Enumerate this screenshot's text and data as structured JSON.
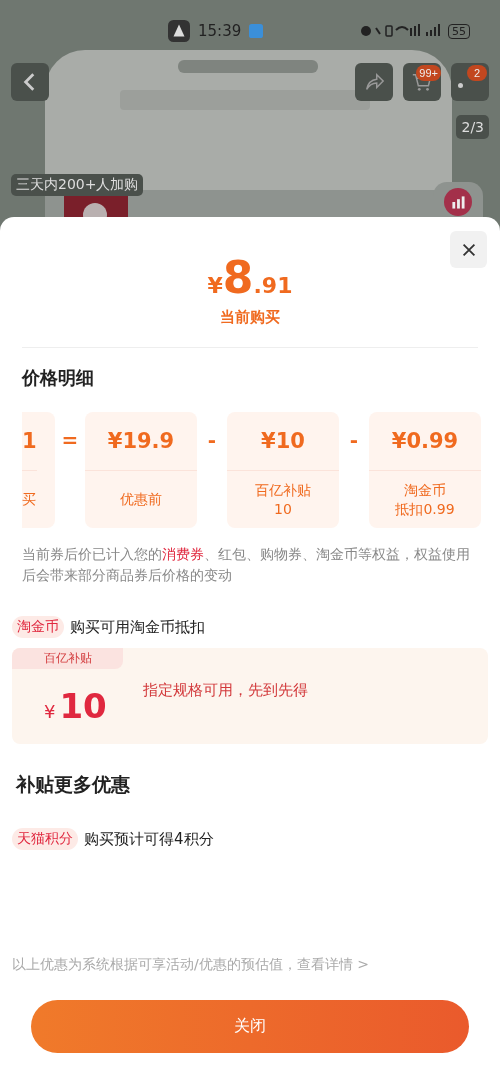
{
  "status_bar": {
    "time": "15:39",
    "battery": "55"
  },
  "product_page": {
    "cart_badge": "99+",
    "more_badge": "2",
    "image_counter": "2/3",
    "social_tag": "三天内200+人加购"
  },
  "sheet": {
    "price": {
      "symbol": "¥",
      "integer": "8",
      "decimal": ".91"
    },
    "price_label": "当前购买",
    "breakdown_title": "价格明细",
    "breakdown": [
      {
        "kind": "cut",
        "value": "1",
        "label": [
          "买"
        ]
      },
      {
        "kind": "operator",
        "value": "="
      },
      {
        "kind": "card",
        "value": "¥19.9",
        "label": [
          "优惠前"
        ]
      },
      {
        "kind": "operator",
        "value": "-"
      },
      {
        "kind": "card",
        "value": "¥10",
        "label": [
          "百亿补贴",
          "10"
        ]
      },
      {
        "kind": "operator",
        "value": "-"
      },
      {
        "kind": "card",
        "value": "¥0.99",
        "label": [
          "淘金币",
          "抵扣0.99"
        ]
      }
    ],
    "note": {
      "before": "当前券后价已计入您的",
      "highlight": "消费券",
      "after": "、红包、购物券、淘金币等权益，权益使用后会带来部分商品券后价格的变动"
    },
    "coin_row": {
      "tag": "淘金币",
      "text": "购买可用淘金币抵扣"
    },
    "subsidy": {
      "badge": "百亿补贴",
      "symbol": "¥",
      "amount": "10",
      "text": "指定规格可用，先到先得"
    },
    "more_title": "补贴更多优惠",
    "points_row": {
      "tag": "天猫积分",
      "text": "购买预计可得4积分"
    },
    "footer": "以上优惠为系统根据可享活动/优惠的预估值，查看详情 >",
    "close_button": "关闭"
  }
}
